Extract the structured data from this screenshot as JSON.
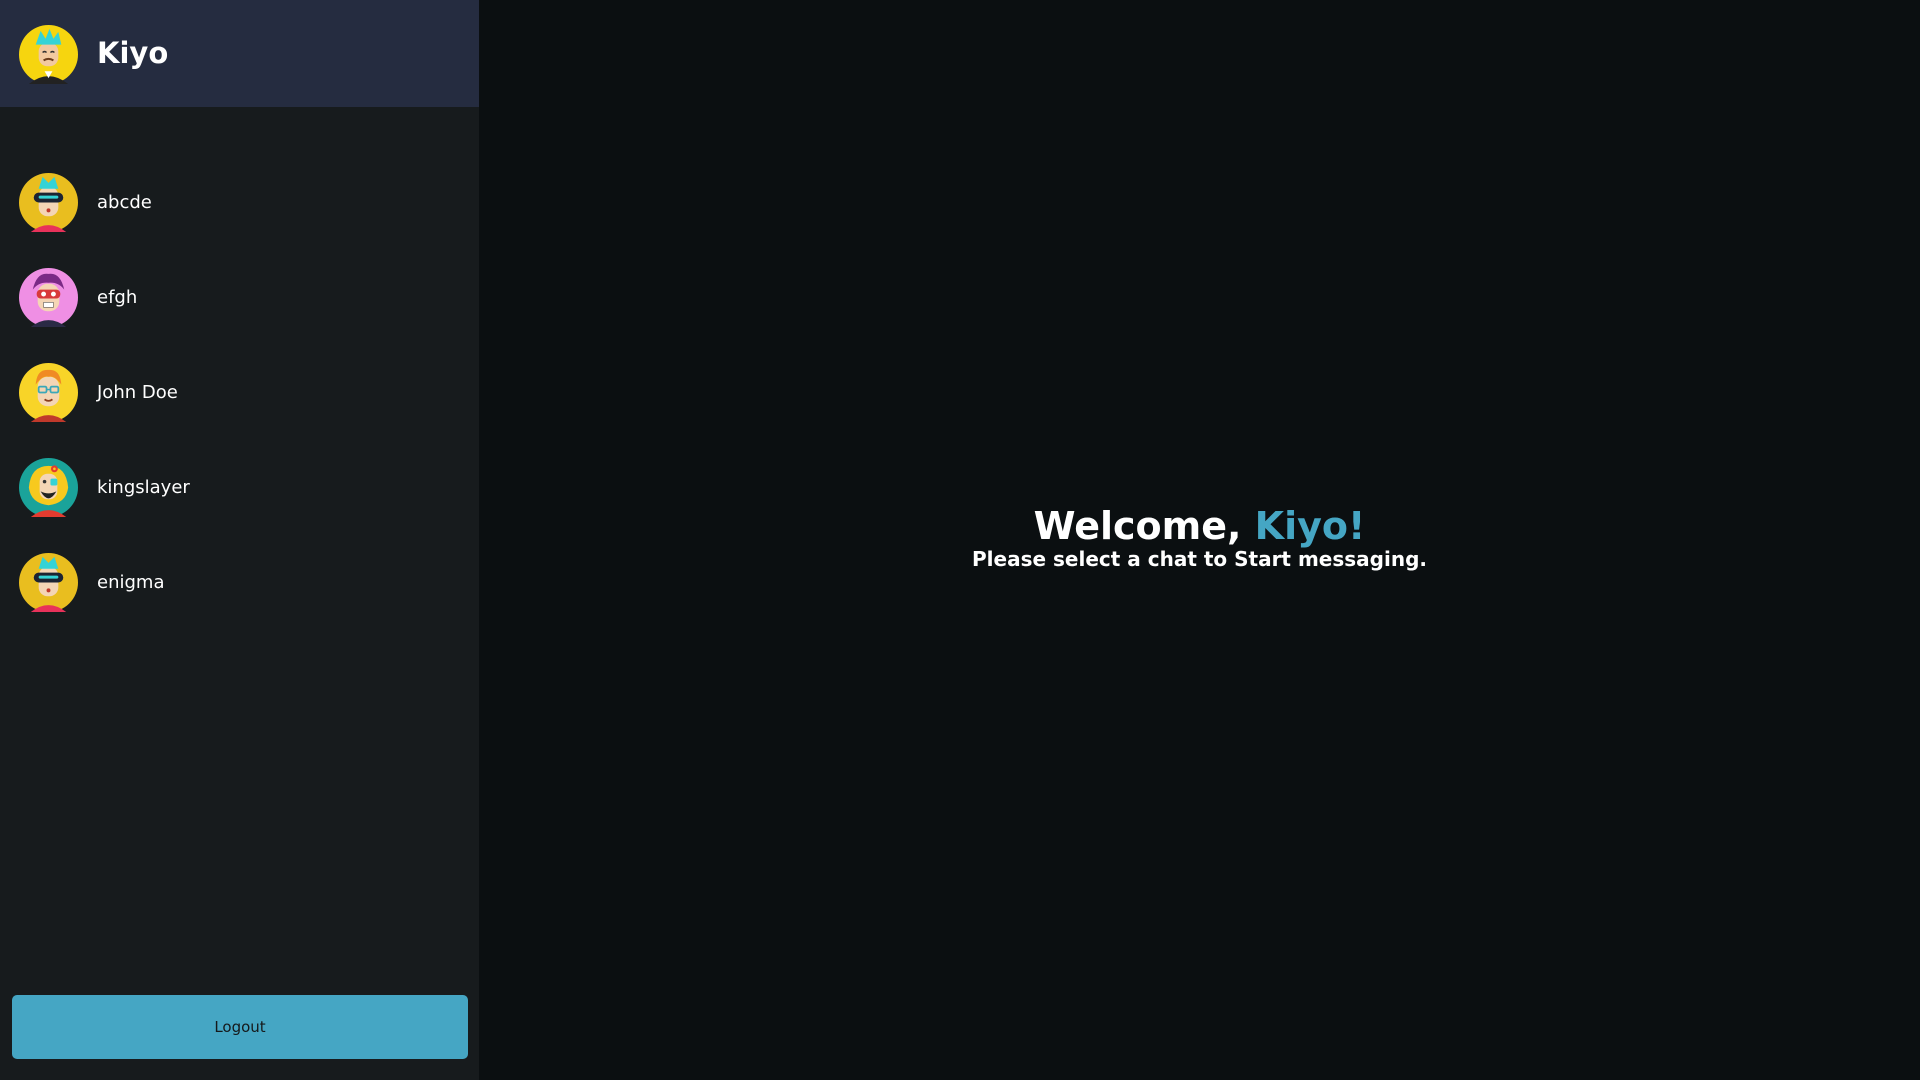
{
  "current_user": {
    "name": "Kiyo",
    "avatar": "yellow-cyan-hair-avatar-icon"
  },
  "chats": [
    {
      "name": "abcde",
      "avatar": "vr-visor-avatar-icon"
    },
    {
      "name": "efgh",
      "avatar": "purple-hair-mask-avatar-icon"
    },
    {
      "name": "John Doe",
      "avatar": "glasses-avatar-icon"
    },
    {
      "name": "kingslayer",
      "avatar": "bearded-flower-avatar-icon"
    },
    {
      "name": "enigma",
      "avatar": "vr-visor-avatar-icon"
    }
  ],
  "welcome": {
    "greeting": "Welcome, ",
    "name": "Kiyo!",
    "subtitle": "Please select a chat to Start messaging."
  },
  "logout_label": "Logout",
  "colors": {
    "accent": "#45a6c4",
    "header_bg": "#252c40",
    "sidebar_bg": "#171b1d",
    "main_bg": "#0b0f11"
  }
}
